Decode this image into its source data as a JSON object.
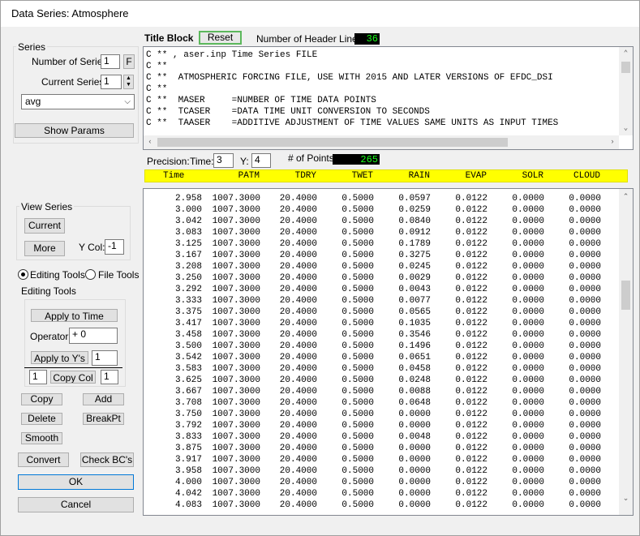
{
  "window": {
    "title": "Data Series: Atmosphere"
  },
  "series": {
    "group_title": "Series",
    "num_label": "Number of Series:",
    "num_value": "1",
    "num_btn": "F",
    "current_label": "Current Series:",
    "current_value": "1",
    "selected": "avg",
    "show_params": "Show Params"
  },
  "view_series": {
    "group_title": "View Series",
    "current_btn": "Current",
    "more_btn": "More",
    "ycol_label": "Y Col:",
    "ycol_value": "-1"
  },
  "tools": {
    "editing_radio": "Editing Tools",
    "file_radio": "File Tools",
    "group_title": "Editing Tools",
    "apply_time": "Apply to Time",
    "operator_label": "Operator:",
    "operator_value": "+ 0",
    "apply_ys": "Apply to Y's",
    "apply_ys_value": "1",
    "copy_from": "1",
    "copy_col": "Copy Col",
    "copy_to": "1",
    "copy": "Copy",
    "add": "Add",
    "delete": "Delete",
    "breakpt": "BreakPt",
    "smooth": "Smooth"
  },
  "bottom": {
    "convert": "Convert",
    "check_bc": "Check BC's",
    "ok": "OK",
    "cancel": "Cancel"
  },
  "title_block": {
    "label": "Title Block",
    "reset": "Reset",
    "header_lines_label": "Number of Header Lines:",
    "header_lines_value": "36",
    "lines": [
      "C ** , aser.inp Time Series FILE",
      "C **",
      "C **  ATMOSPHERIC FORCING FILE, USE WITH 2015 AND LATER VERSIONS OF EFDC_DSI",
      "C **",
      "C **  MASER     =NUMBER OF TIME DATA POINTS",
      "C **  TCASER    =DATA TIME UNIT CONVERSION TO SECONDS",
      "C **  TAASER    =ADDITIVE ADJUSTMENT OF TIME VALUES SAME UNITS AS INPUT TIMES"
    ]
  },
  "precision": {
    "label": "Precision:",
    "time_label": "Time:",
    "time_value": "3",
    "y_label": "Y:",
    "y_value": "4",
    "points_label": "# of Points:",
    "points_value": "265"
  },
  "columns": [
    "Time",
    "PATM",
    "TDRY",
    "TWET",
    "RAIN",
    "EVAP",
    "SOLR",
    "CLOUD"
  ],
  "rows": [
    [
      "2.958",
      "1007.3000",
      "20.4000",
      "0.5000",
      "0.0597",
      "0.0122",
      "0.0000",
      "0.0000"
    ],
    [
      "3.000",
      "1007.3000",
      "20.4000",
      "0.5000",
      "0.0259",
      "0.0122",
      "0.0000",
      "0.0000"
    ],
    [
      "3.042",
      "1007.3000",
      "20.4000",
      "0.5000",
      "0.0840",
      "0.0122",
      "0.0000",
      "0.0000"
    ],
    [
      "3.083",
      "1007.3000",
      "20.4000",
      "0.5000",
      "0.0912",
      "0.0122",
      "0.0000",
      "0.0000"
    ],
    [
      "3.125",
      "1007.3000",
      "20.4000",
      "0.5000",
      "0.1789",
      "0.0122",
      "0.0000",
      "0.0000"
    ],
    [
      "3.167",
      "1007.3000",
      "20.4000",
      "0.5000",
      "0.3275",
      "0.0122",
      "0.0000",
      "0.0000"
    ],
    [
      "3.208",
      "1007.3000",
      "20.4000",
      "0.5000",
      "0.0245",
      "0.0122",
      "0.0000",
      "0.0000"
    ],
    [
      "3.250",
      "1007.3000",
      "20.4000",
      "0.5000",
      "0.0029",
      "0.0122",
      "0.0000",
      "0.0000"
    ],
    [
      "3.292",
      "1007.3000",
      "20.4000",
      "0.5000",
      "0.0043",
      "0.0122",
      "0.0000",
      "0.0000"
    ],
    [
      "3.333",
      "1007.3000",
      "20.4000",
      "0.5000",
      "0.0077",
      "0.0122",
      "0.0000",
      "0.0000"
    ],
    [
      "3.375",
      "1007.3000",
      "20.4000",
      "0.5000",
      "0.0565",
      "0.0122",
      "0.0000",
      "0.0000"
    ],
    [
      "3.417",
      "1007.3000",
      "20.4000",
      "0.5000",
      "0.1035",
      "0.0122",
      "0.0000",
      "0.0000"
    ],
    [
      "3.458",
      "1007.3000",
      "20.4000",
      "0.5000",
      "0.3546",
      "0.0122",
      "0.0000",
      "0.0000"
    ],
    [
      "3.500",
      "1007.3000",
      "20.4000",
      "0.5000",
      "0.1496",
      "0.0122",
      "0.0000",
      "0.0000"
    ],
    [
      "3.542",
      "1007.3000",
      "20.4000",
      "0.5000",
      "0.0651",
      "0.0122",
      "0.0000",
      "0.0000"
    ],
    [
      "3.583",
      "1007.3000",
      "20.4000",
      "0.5000",
      "0.0458",
      "0.0122",
      "0.0000",
      "0.0000"
    ],
    [
      "3.625",
      "1007.3000",
      "20.4000",
      "0.5000",
      "0.0248",
      "0.0122",
      "0.0000",
      "0.0000"
    ],
    [
      "3.667",
      "1007.3000",
      "20.4000",
      "0.5000",
      "0.0088",
      "0.0122",
      "0.0000",
      "0.0000"
    ],
    [
      "3.708",
      "1007.3000",
      "20.4000",
      "0.5000",
      "0.0648",
      "0.0122",
      "0.0000",
      "0.0000"
    ],
    [
      "3.750",
      "1007.3000",
      "20.4000",
      "0.5000",
      "0.0000",
      "0.0122",
      "0.0000",
      "0.0000"
    ],
    [
      "3.792",
      "1007.3000",
      "20.4000",
      "0.5000",
      "0.0000",
      "0.0122",
      "0.0000",
      "0.0000"
    ],
    [
      "3.833",
      "1007.3000",
      "20.4000",
      "0.5000",
      "0.0048",
      "0.0122",
      "0.0000",
      "0.0000"
    ],
    [
      "3.875",
      "1007.3000",
      "20.4000",
      "0.5000",
      "0.0000",
      "0.0122",
      "0.0000",
      "0.0000"
    ],
    [
      "3.917",
      "1007.3000",
      "20.4000",
      "0.5000",
      "0.0000",
      "0.0122",
      "0.0000",
      "0.0000"
    ],
    [
      "3.958",
      "1007.3000",
      "20.4000",
      "0.5000",
      "0.0000",
      "0.0122",
      "0.0000",
      "0.0000"
    ],
    [
      "4.000",
      "1007.3000",
      "20.4000",
      "0.5000",
      "0.0000",
      "0.0122",
      "0.0000",
      "0.0000"
    ],
    [
      "4.042",
      "1007.3000",
      "20.4000",
      "0.5000",
      "0.0000",
      "0.0122",
      "0.0000",
      "0.0000"
    ],
    [
      "4.083",
      "1007.3000",
      "20.4000",
      "0.5000",
      "0.0000",
      "0.0122",
      "0.0000",
      "0.0000"
    ]
  ],
  "colors": {
    "header_yellow": "#ffff00",
    "counter_green": "#19ff19",
    "reset_border": "#5cb85c",
    "focus_blue": "#0078d7"
  },
  "icons": {
    "dropdown": "chevron-down-icon",
    "spin": "spin-arrows-icon"
  }
}
